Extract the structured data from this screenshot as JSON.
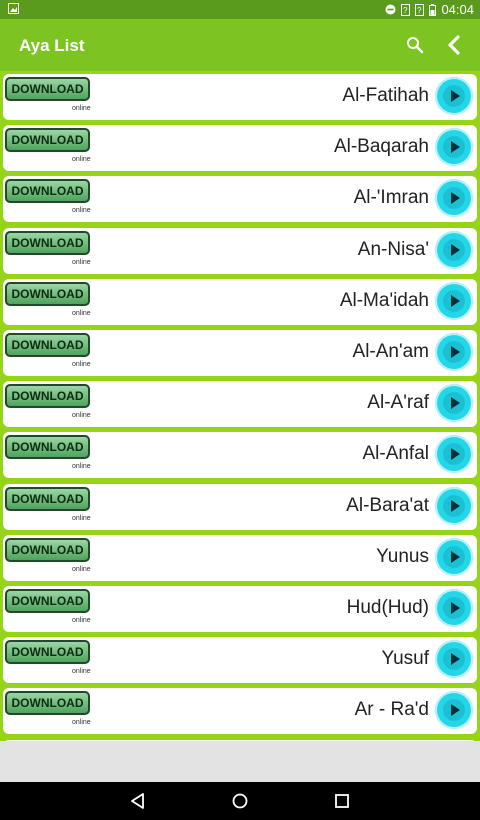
{
  "status_bar": {
    "time": "04:04"
  },
  "app_bar": {
    "title": "Aya List"
  },
  "download_label": "DOWNLOAD",
  "online_label": "online",
  "ayas": [
    {
      "name": "Al-Fatihah"
    },
    {
      "name": "Al-Baqarah"
    },
    {
      "name": "Al-'Imran"
    },
    {
      "name": "An-Nisa'"
    },
    {
      "name": "Al-Ma'idah"
    },
    {
      "name": "Al-An'am"
    },
    {
      "name": "Al-A'raf"
    },
    {
      "name": "Al-Anfal"
    },
    {
      "name": "Al-Bara'at"
    },
    {
      "name": "Yunus"
    },
    {
      "name": "Hud(Hud)"
    },
    {
      "name": "Yusuf"
    },
    {
      "name": "Ar - Ra'd"
    }
  ],
  "icons": {
    "search": "search-icon",
    "back": "chevron-left-icon",
    "play": "play-icon",
    "nav_back": "nav-back-icon",
    "nav_home": "nav-home-icon",
    "nav_recents": "nav-recents-icon"
  },
  "colors": {
    "status_bar": "#5a9a1c",
    "app_bar": "#7cc421",
    "list_background": "#95d419",
    "play_button": "#24d7e8",
    "download_button": "#4fa35c"
  }
}
